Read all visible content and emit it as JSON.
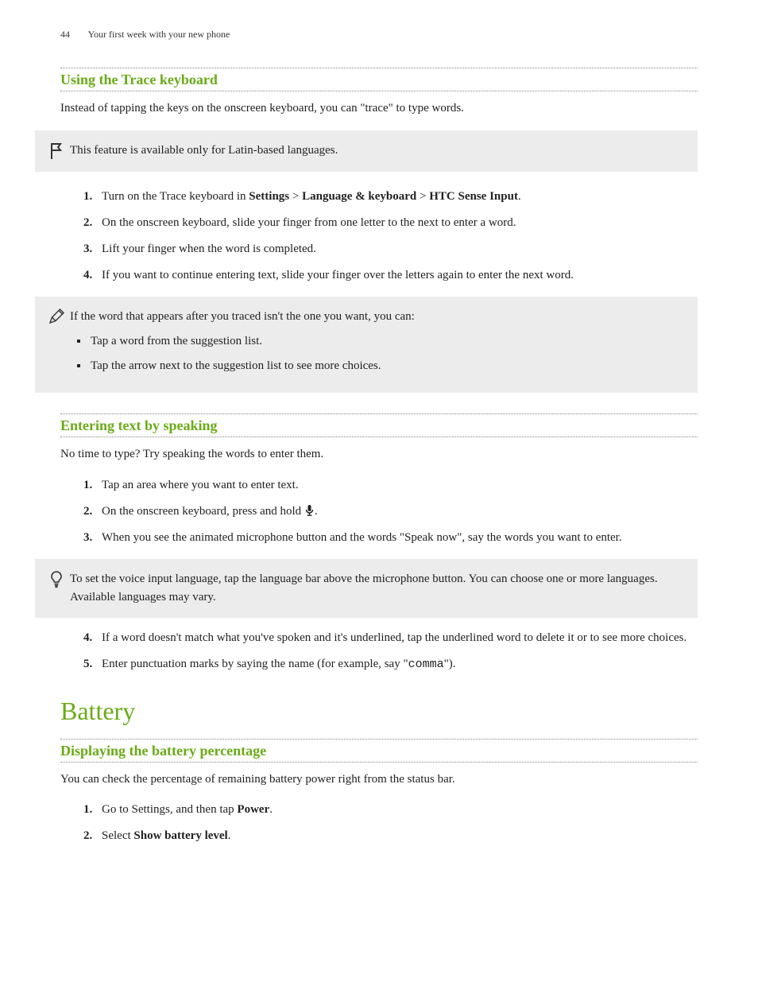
{
  "header": {
    "page_number": "44",
    "running_title": "Your first week with your new phone"
  },
  "sec1": {
    "heading": "Using the Trace keyboard",
    "intro": "Instead of tapping the keys on the onscreen keyboard, you can \"trace\" to type words.",
    "flag_note": "This feature is available only for Latin-based languages.",
    "step1_pre": "Turn on the Trace keyboard in ",
    "step1_b1": "Settings",
    "step1_gt1": " > ",
    "step1_b2": "Language & keyboard",
    "step1_gt2": " > ",
    "step1_b3": "HTC Sense Input",
    "step1_post": ".",
    "step2": "On the onscreen keyboard, slide your finger from one letter to the next to enter a word.",
    "step3": "Lift your finger when the word is completed.",
    "step4": "If you want to continue entering text, slide your finger over the letters again to enter the next word.",
    "pencil_lead": "If the word that appears after you traced isn't the one you want, you can:",
    "pencil_b1": "Tap a word from the suggestion list.",
    "pencil_b2": "Tap the arrow next to the suggestion list to see more choices."
  },
  "sec2": {
    "heading": "Entering text by speaking",
    "intro": "No time to type? Try speaking the words to enter them.",
    "step1": "Tap an area where you want to enter text.",
    "step2_pre": "On the onscreen keyboard, press and hold ",
    "step2_post": ".",
    "step3": "When you see the animated microphone button and the words \"Speak now\", say the words you want to enter.",
    "tip": "To set the voice input language, tap the language bar above the microphone button. You can choose one or more languages. Available languages may vary.",
    "step4": "If a word doesn't match what you've spoken and it's underlined, tap the underlined word to delete it or to see more choices.",
    "step5_pre": "Enter punctuation marks by saying the name (for example, say \"",
    "step5_code": "comma",
    "step5_post": "\")."
  },
  "sec3": {
    "title": "Battery",
    "heading": "Displaying the battery percentage",
    "intro": "You can check the percentage of remaining battery power right from the status bar.",
    "step1_pre": "Go to Settings, and then tap ",
    "step1_b": "Power",
    "step1_post": ".",
    "step2_pre": "Select ",
    "step2_b": "Show battery level",
    "step2_post": "."
  }
}
